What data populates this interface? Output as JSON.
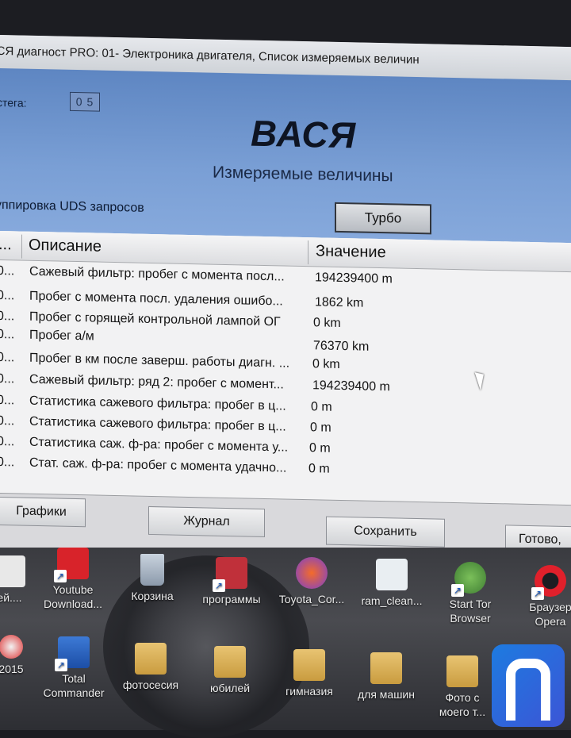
{
  "window": {
    "title": "АСЯ диагност PRO: 01- Электроника двигателя,  Список измеряемых величин"
  },
  "header": {
    "tab_label": "стега:",
    "tab_value": "0 5",
    "logo": "ВАСЯ",
    "subtitle": "Измеряемые величины",
    "grouping_label": "уппировка UDS запросов",
    "turbo_button": "Турбо"
  },
  "table": {
    "columns": {
      "index": "...",
      "description": "Описание",
      "value": "Значение"
    },
    "rows": [
      {
        "index": "0...",
        "description": "Сажевый фильтр: пробег с момента посл...",
        "value": "194239400 m"
      },
      {
        "index": "0...",
        "description": "Пробег с момента посл. удаления ошибо...",
        "value": "1862 km"
      },
      {
        "index": "0...",
        "description": "Пробег с горящей контрольной лампой ОГ",
        "value": "0 km"
      },
      {
        "index": "0...",
        "description": "Пробег а/м",
        "value": "76370 km"
      },
      {
        "index": "0...",
        "description": "Пробег в км после заверш. работы диагн. ...",
        "value": "0 km"
      },
      {
        "index": "0...",
        "description": "Сажевый фильтр: ряд 2: пробег с момент...",
        "value": "194239400 m"
      },
      {
        "index": "0...",
        "description": "Статистика сажевого фильтра: пробег в ц...",
        "value": "0 m"
      },
      {
        "index": "0...",
        "description": "Статистика сажевого фильтра: пробег в ц...",
        "value": "0 m"
      },
      {
        "index": "0...",
        "description": "Статистика саж. ф-ра: пробег с момента у...",
        "value": "0 m"
      },
      {
        "index": "0...",
        "description": "Стат. саж. ф-ра: пробег с момента удачно...",
        "value": "0 m"
      }
    ]
  },
  "buttons": {
    "graphs": "Графики",
    "journal": "Журнал",
    "save": "Сохранить",
    "done": "Готово,"
  },
  "desktop": {
    "icons": [
      {
        "label": "ей...."
      },
      {
        "label": "Youtube Download..."
      },
      {
        "label": "Корзина"
      },
      {
        "label": "программы"
      },
      {
        "label": "Toyota_Cor..."
      },
      {
        "label": "ram_clean..."
      },
      {
        "label": "Start Tor Browser"
      },
      {
        "label": "Браузер Opera"
      },
      {
        "label": "2015"
      },
      {
        "label": "Total Commander"
      },
      {
        "label": "фотосесия"
      },
      {
        "label": "юбилей"
      },
      {
        "label": "гимназия"
      },
      {
        "label": "для машин"
      },
      {
        "label": "Фото с моего т..."
      }
    ]
  }
}
